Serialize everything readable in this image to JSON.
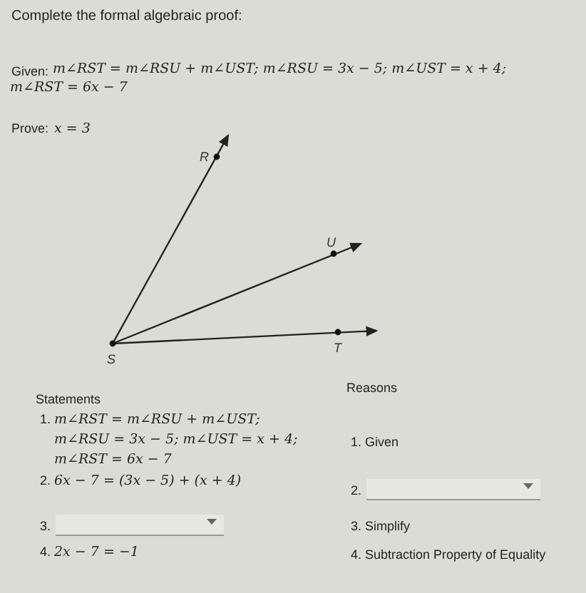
{
  "instruction": "Complete the formal algebraic proof:",
  "given": {
    "label": "Given:",
    "lines": [
      "m∠RST = m∠RSU + m∠UST; m∠RSU = 3x − 5; m∠UST = x + 4;",
      "m∠RST = 6x − 7"
    ]
  },
  "prove": {
    "label": "Prove:",
    "statement": "x = 3"
  },
  "diagram": {
    "points": [
      "R",
      "U",
      "S",
      "T"
    ]
  },
  "proof": {
    "statements_heading": "Statements",
    "reasons_heading": "Reasons",
    "rows": [
      {
        "statement": {
          "kind": "text",
          "number": "1.",
          "lines": [
            "m∠RST = m∠RSU + m∠UST;",
            "m∠RSU = 3x − 5; m∠UST = x + 4;",
            "m∠RST = 6x − 7"
          ]
        },
        "reason": {
          "kind": "text",
          "text": "1. Given"
        }
      },
      {
        "statement": {
          "kind": "text",
          "number": "2.",
          "lines": [
            "6x − 7 = (3x − 5) + (x + 4)"
          ]
        },
        "reason": {
          "kind": "dropdown",
          "number": "2."
        }
      },
      {
        "statement": {
          "kind": "dropdown",
          "number": "3."
        },
        "reason": {
          "kind": "text",
          "text": "3. Simplify"
        }
      },
      {
        "statement": {
          "kind": "text",
          "number": "4.",
          "lines": [
            "2x − 7 = −1"
          ]
        },
        "reason": {
          "kind": "text",
          "text": "4. Subtraction Property of Equality"
        }
      }
    ]
  }
}
